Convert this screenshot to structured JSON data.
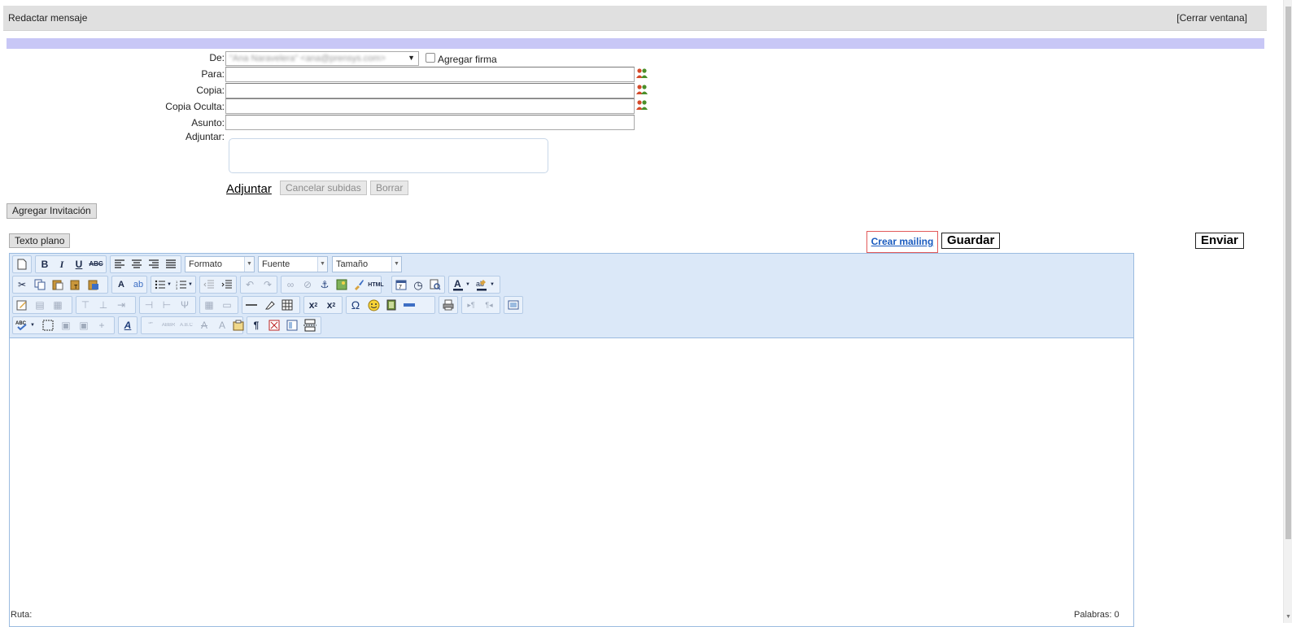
{
  "window": {
    "title": "Redactar mensaje",
    "close_label": "[Cerrar ventana]"
  },
  "form": {
    "from_label": "De:",
    "from_value": "\"Ana Naravelera\" <ana@prensys.com>",
    "signature_label": "Agregar firma",
    "to_label": "Para:",
    "cc_label": "Copia:",
    "bcc_label": "Copia Oculta:",
    "subject_label": "Asunto:",
    "attach_label": "Adjuntar:",
    "attach_link": "Adjuntar",
    "cancel_uploads": "Cancelar subidas",
    "delete": "Borrar"
  },
  "actions": {
    "add_invitation": "Agregar Invitación",
    "plain_text": "Texto plano",
    "create_mailing": "Crear mailing",
    "save": "Guardar",
    "send": "Enviar"
  },
  "editor": {
    "format": "Formato",
    "font": "Fuente",
    "size": "Tamaño",
    "status_left": "Ruta:",
    "status_right": "Palabras: 0"
  },
  "colors": {
    "accent_bar": "#c8c7f6",
    "toolbar_bg": "#dbe8f8",
    "link": "#1a5bbf",
    "highlight_border": "#e25a5a"
  }
}
